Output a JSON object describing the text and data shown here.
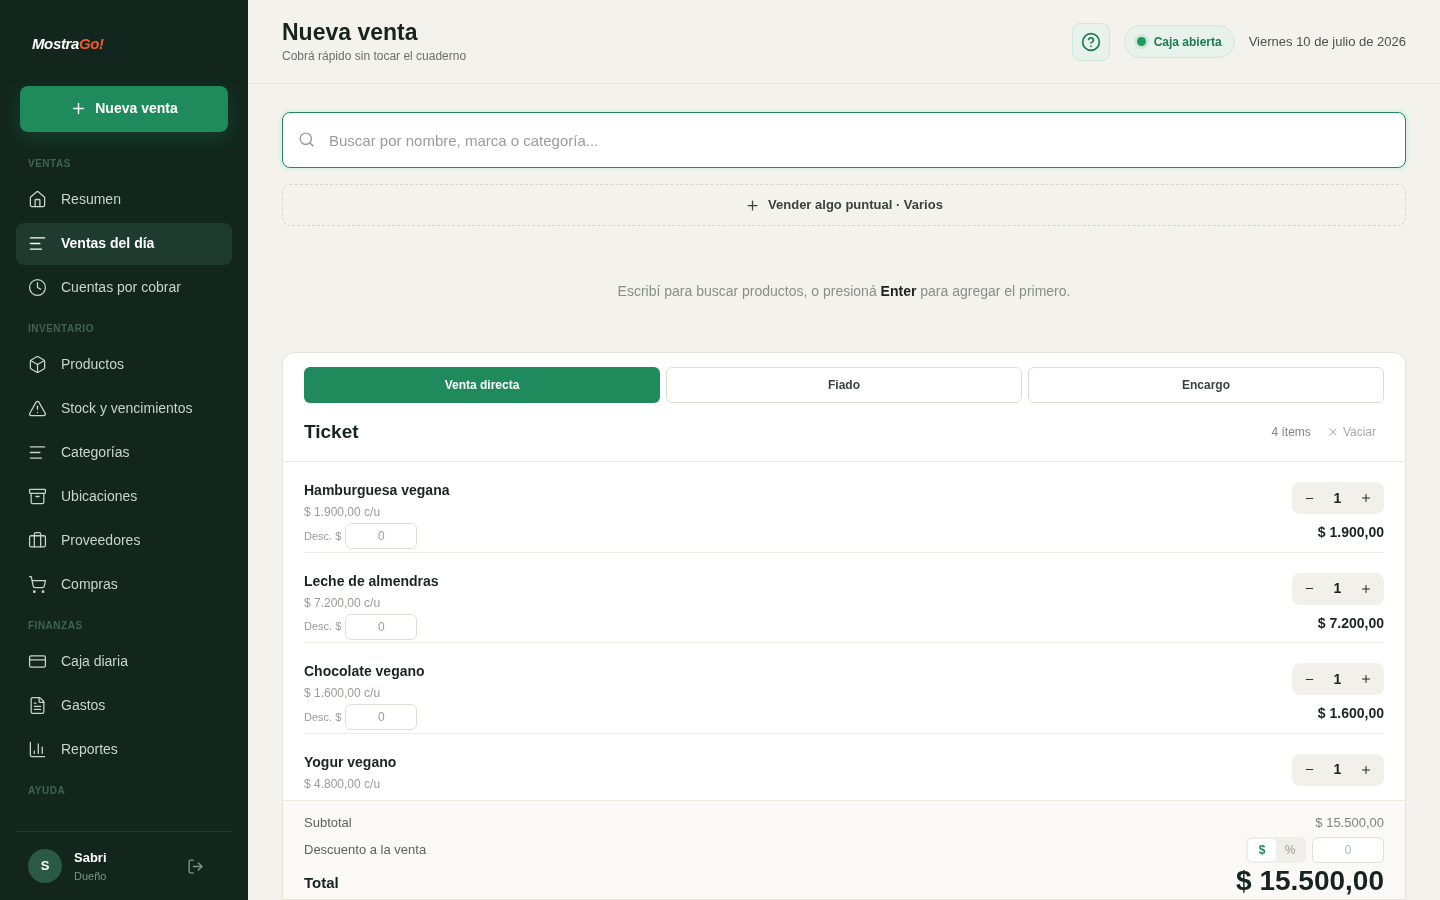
{
  "sidebar": {
    "logo": {
      "main": "Mostra",
      "accent": "Go!"
    },
    "new_sale_button": "Nueva venta",
    "sections": [
      {
        "heading": "VENTAS",
        "items": [
          {
            "label": "Resumen",
            "selected": false
          },
          {
            "label": "Ventas del día",
            "selected": true
          },
          {
            "label": "Cuentas por cobrar",
            "selected": false
          }
        ]
      },
      {
        "heading": "INVENTARIO",
        "items": [
          {
            "label": "Productos",
            "selected": false
          },
          {
            "label": "Stock y vencimientos",
            "selected": false
          },
          {
            "label": "Categorías",
            "selected": false
          },
          {
            "label": "Ubicaciones",
            "selected": false
          },
          {
            "label": "Proveedores",
            "selected": false
          },
          {
            "label": "Compras",
            "selected": false
          }
        ]
      },
      {
        "heading": "FINANZAS",
        "items": [
          {
            "label": "Caja diaria",
            "selected": false
          },
          {
            "label": "Gastos",
            "selected": false
          },
          {
            "label": "Reportes",
            "selected": false
          }
        ]
      },
      {
        "heading": "AYUDA"
      }
    ],
    "user": {
      "initial": "S",
      "name": "Sabri",
      "role": "Dueño"
    }
  },
  "header": {
    "title": "Nueva venta",
    "subtitle": "Cobrá rápido sin tocar el cuaderno",
    "status": {
      "label": "Caja abierta",
      "color": "#1f9a5e"
    },
    "date": "Viernes 10 de julio de 2026"
  },
  "search": {
    "placeholder": "Buscar por nombre, marca o categoría..."
  },
  "misc_button": "Vender algo puntual · Varios",
  "hint": "Escribí para buscar productos, o presioná **Enter** para agregar el primero.",
  "sale": {
    "tabs": [
      {
        "label": "Venta directa",
        "selected": true
      },
      {
        "label": "Fiado",
        "selected": false
      },
      {
        "label": "Encargo",
        "selected": false
      }
    ],
    "ticket_title": "Ticket",
    "item_count": "4 ítems",
    "clear_button": "Vaciar",
    "items": [
      {
        "name": "Hamburguesa vegana",
        "unit_price": "$ 1.900,00 c/u",
        "discount_label": "Desc. $",
        "discount": "0",
        "qty": "1",
        "total": "$ 1.900,00"
      },
      {
        "name": "Leche de almendras",
        "unit_price": "$ 7.200,00 c/u",
        "discount_label": "Desc. $",
        "discount": "0",
        "qty": "1",
        "total": "$ 7.200,00"
      },
      {
        "name": "Chocolate vegano",
        "unit_price": "$ 1.600,00 c/u",
        "discount_label": "Desc. $",
        "discount": "0",
        "qty": "1",
        "total": "$ 1.600,00"
      },
      {
        "name": "Yogur vegano",
        "unit_price": "$ 4.800,00 c/u",
        "qty": "1"
      }
    ],
    "subtotal_label": "Subtotal",
    "subtotal": "$ 15.500,00",
    "discount_label": "Descuento a la venta",
    "discount_modes": [
      {
        "label": "$",
        "selected": true
      },
      {
        "label": "%",
        "selected": false
      }
    ],
    "discount_placeholder": "0",
    "total_label": "Total",
    "total": "$ 15.500,00"
  }
}
